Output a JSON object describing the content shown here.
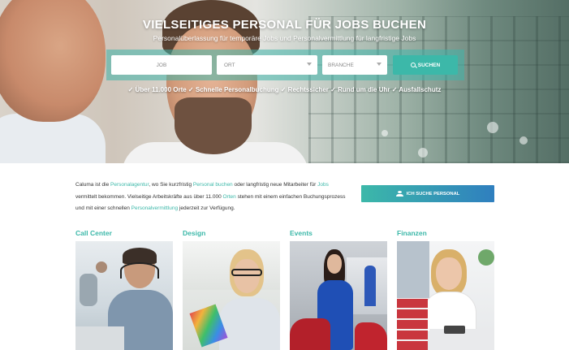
{
  "hero": {
    "title": "VIELSEITIGES PERSONAL FÜR JOBS BUCHEN",
    "subtitle": "Personalüberlassung für temporäre Jobs und Personalvermittlung für langfristige Jobs",
    "search": {
      "job_placeholder": "JOB",
      "ort_placeholder": "ORT",
      "branche_placeholder": "BRANCHE",
      "button_label": "SUCHEN"
    },
    "usp_line": "✓ Über 11.000 Orte ✓ Schnelle Personalbuchung ✓ Rechtssicher ✓ Rund um die Uhr ✓ Ausfallschutz"
  },
  "intro": {
    "t1": "Caluma ist die ",
    "l1": "Personalagentur",
    "t2": ", wo Sie kurzfristig ",
    "l2": "Personal buchen",
    "t3": " oder langfristig neue Mitarbeiter für ",
    "l3": "Jobs",
    "t4": " vermittelt bekommen. Vielseitige Arbeitskräfte aus über 11.000 ",
    "l4": "Orten",
    "t5": " stehen mit einem einfachen Buchungsprozess und mit einer schnellen ",
    "l5": "Personalvermittlung",
    "t6": " jederzeit zur Verfügung.",
    "cta_label": "ICH SUCHE PERSONAL",
    "accent_color": "#3cb8a9"
  },
  "categories": [
    {
      "title": "Call Center"
    },
    {
      "title": "Design"
    },
    {
      "title": "Events"
    },
    {
      "title": "Finanzen"
    }
  ]
}
